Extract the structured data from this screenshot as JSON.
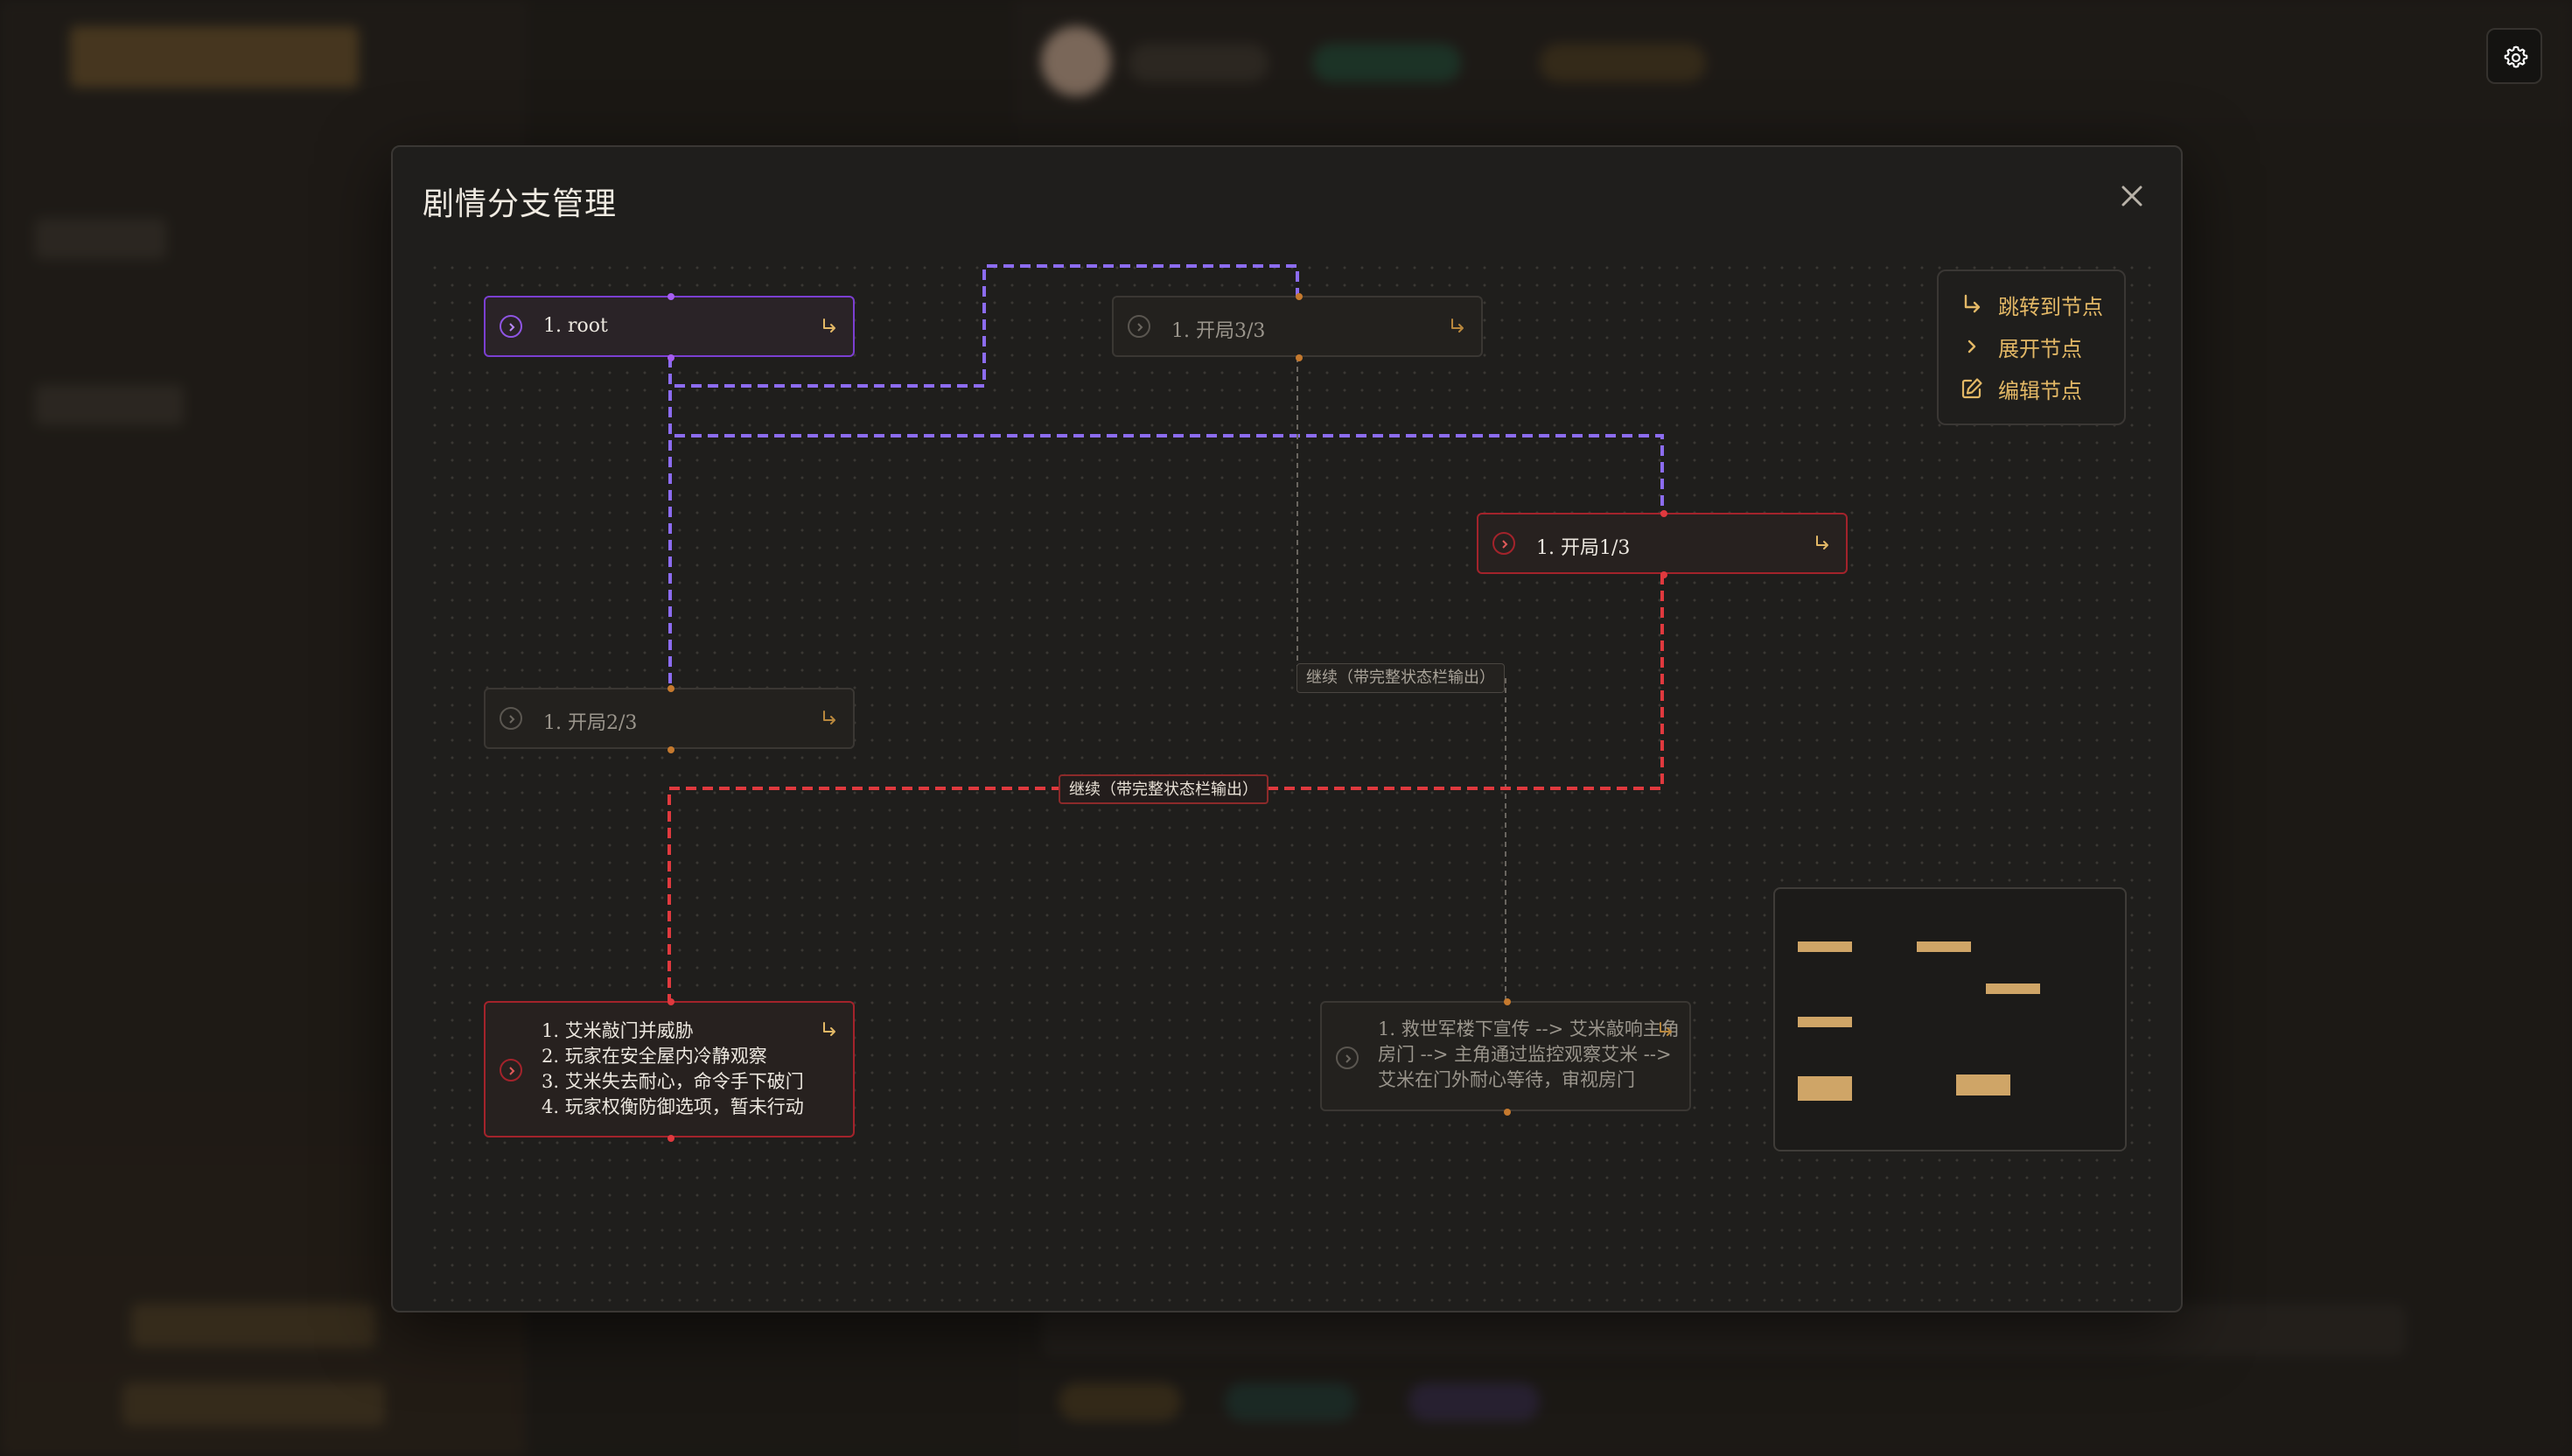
{
  "dialog": {
    "title": "剧情分支管理",
    "close_icon": "close-icon"
  },
  "nodes": {
    "root": {
      "label": "1. root"
    },
    "opening_3_3": {
      "label": "1. 开局3/3"
    },
    "opening_1_3": {
      "label": "1. 开局1/3"
    },
    "opening_2_3": {
      "label": "1. 开局2/3"
    },
    "current_branch": {
      "lines": [
        "1. 艾米敲门并威胁",
        "2. 玩家在安全屋内冷静观察",
        "3. 艾米失去耐心，命令手下破门",
        "4. 玩家权衡防御选项，暂未行动"
      ]
    },
    "alt_branch": {
      "lines": [
        "1. 救世军楼下宣传 --> 艾米敲响主角",
        "房门 --> 主角通过监控观察艾米 -->",
        "艾米在门外耐心等待，审视房门"
      ]
    }
  },
  "edge_labels": {
    "active": "继续（带完整状态栏输出）",
    "inactive": "继续（带完整状态栏输出）"
  },
  "legend_menu": {
    "items": [
      {
        "label": "跳转到节点",
        "icon": "jump-to-node-icon"
      },
      {
        "label": "展开节点",
        "icon": "chevron-right-icon"
      },
      {
        "label": "编辑节点",
        "icon": "edit-icon"
      }
    ]
  },
  "colors": {
    "accent_gold": "#e3b866",
    "root_edge": "#8c6cf0",
    "active_edge": "#e0393e",
    "inactive_edge": "#6a6660"
  },
  "settings_icon": "gear-icon"
}
